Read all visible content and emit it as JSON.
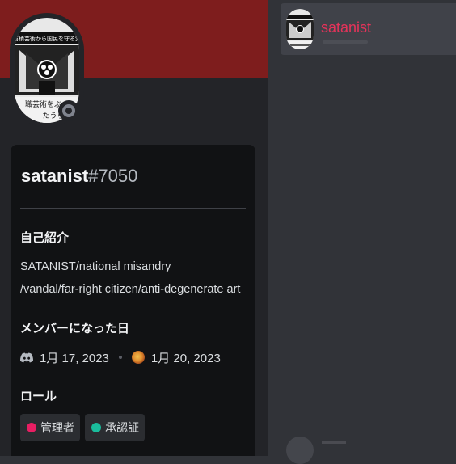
{
  "profile": {
    "username": "satanist",
    "discriminator": "#7050",
    "avatar_text_top": "蓄積芸術から国民を守る党",
    "avatar_text_bottom_1": "職芸術をぶっ",
    "avatar_text_bottom_2": "たうら"
  },
  "about": {
    "heading": "自己紹介",
    "line1": "SATANIST/national misandry",
    "line2": "/vandal/far-right citizen/anti-degenerate art"
  },
  "member_since": {
    "heading": "メンバーになった日",
    "discord_date": "1月 17, 2023",
    "server_date": "1月 20, 2023",
    "discord_icon": "discord-icon",
    "server_icon": "server-icon"
  },
  "roles": {
    "heading": "ロール",
    "items": [
      {
        "label": "管理者",
        "color": "#e91e63"
      },
      {
        "label": "承認証",
        "color": "#1abc9c"
      }
    ]
  },
  "member_list": {
    "name": "satanist",
    "name_color": "#e6335a"
  },
  "colors": {
    "banner": "#7e1d1d",
    "status": "#80848e"
  }
}
